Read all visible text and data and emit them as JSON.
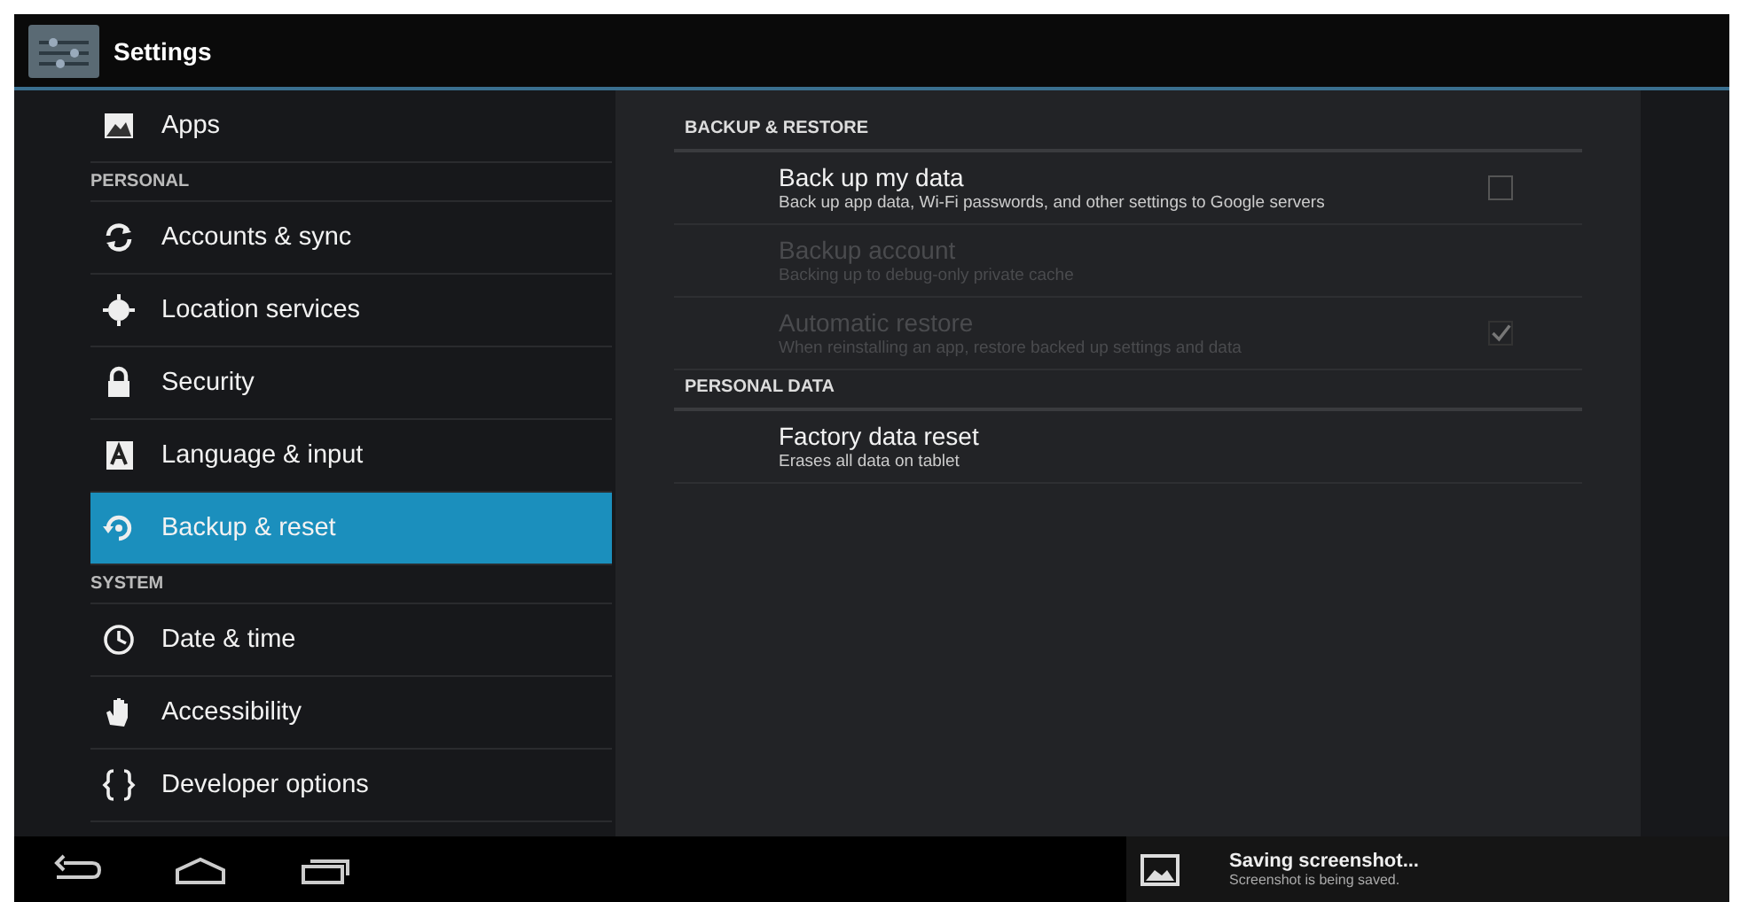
{
  "action_bar": {
    "title": "Settings"
  },
  "sidebar": {
    "items": [
      {
        "kind": "item",
        "label": "Apps",
        "selected": false
      },
      {
        "kind": "header",
        "label": "PERSONAL"
      },
      {
        "kind": "item",
        "label": "Accounts & sync",
        "selected": false
      },
      {
        "kind": "item",
        "label": "Location services",
        "selected": false
      },
      {
        "kind": "item",
        "label": "Security",
        "selected": false
      },
      {
        "kind": "item",
        "label": "Language & input",
        "selected": false
      },
      {
        "kind": "item",
        "label": "Backup & reset",
        "selected": true
      },
      {
        "kind": "header",
        "label": "SYSTEM"
      },
      {
        "kind": "item",
        "label": "Date & time",
        "selected": false
      },
      {
        "kind": "item",
        "label": "Accessibility",
        "selected": false
      },
      {
        "kind": "item",
        "label": "Developer options",
        "selected": false
      }
    ]
  },
  "detail": {
    "sections": [
      {
        "header": "BACKUP & RESTORE",
        "rows": [
          {
            "title": "Back up my data",
            "summary": "Back up app data, Wi-Fi passwords, and other settings to Google servers",
            "disabled": false,
            "kind": "checkbox",
            "checked": false
          },
          {
            "title": "Backup account",
            "summary": "Backing up to debug-only private cache",
            "disabled": true,
            "kind": "plain"
          },
          {
            "title": "Automatic restore",
            "summary": "When reinstalling an app, restore backed up settings and data",
            "disabled": true,
            "kind": "checkbox",
            "checked": true
          }
        ]
      },
      {
        "header": "PERSONAL DATA",
        "rows": [
          {
            "title": "Factory data reset",
            "summary": "Erases all data on tablet",
            "disabled": false,
            "kind": "plain"
          }
        ]
      }
    ]
  },
  "notification": {
    "title": "Saving screenshot...",
    "text": "Screenshot is being saved."
  }
}
